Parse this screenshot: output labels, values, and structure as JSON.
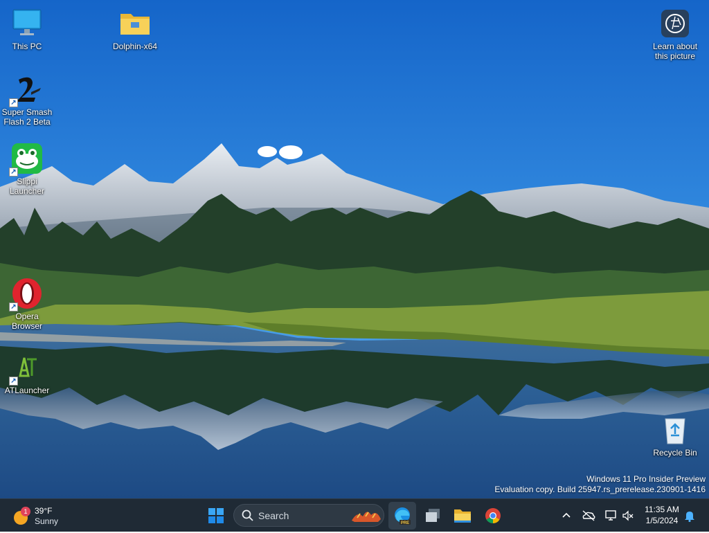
{
  "desktop": {
    "icons": [
      {
        "label": "This PC",
        "icon": "monitor-icon"
      },
      {
        "label": "Dolphin-x64",
        "icon": "folder-icon"
      },
      {
        "label": "Super Smash Flash 2 Beta",
        "icon": "ssf2-icon"
      },
      {
        "label": "Slippi Launcher",
        "icon": "frog-icon"
      },
      {
        "label": "Opera Browser",
        "icon": "opera-icon"
      },
      {
        "label": "ATLauncher",
        "icon": "atlauncher-icon"
      },
      {
        "label": "Learn about this picture",
        "icon": "camera-icon"
      },
      {
        "label": "Recycle Bin",
        "icon": "recycle-bin-icon"
      }
    ]
  },
  "watermark": {
    "line1": "Windows 11 Pro Insider Preview",
    "line2": "Evaluation copy. Build 25947.rs_prerelease.230901-1416"
  },
  "taskbar": {
    "weather": {
      "temp": "39°F",
      "condition": "Sunny",
      "badge": "1",
      "icon": "sun-icon"
    },
    "search_label": "Search",
    "pinned": [
      {
        "icon": "windows-start-icon"
      },
      {
        "icon": "edge-preview-icon",
        "active": true
      },
      {
        "icon": "task-view-icon"
      },
      {
        "icon": "file-explorer-icon"
      },
      {
        "icon": "chrome-icon"
      }
    ],
    "tray": {
      "icons": [
        "chevron-up-icon",
        "onedrive-offline-icon",
        "network-icon",
        "volume-muted-icon"
      ],
      "time": "11:35 AM",
      "date": "1/5/2024",
      "notification_icon": "bell-icon"
    }
  },
  "colors": {
    "taskbar_bg": "#1f2a35",
    "sky_top": "#1a6fd1",
    "accent": "#0078d4"
  }
}
